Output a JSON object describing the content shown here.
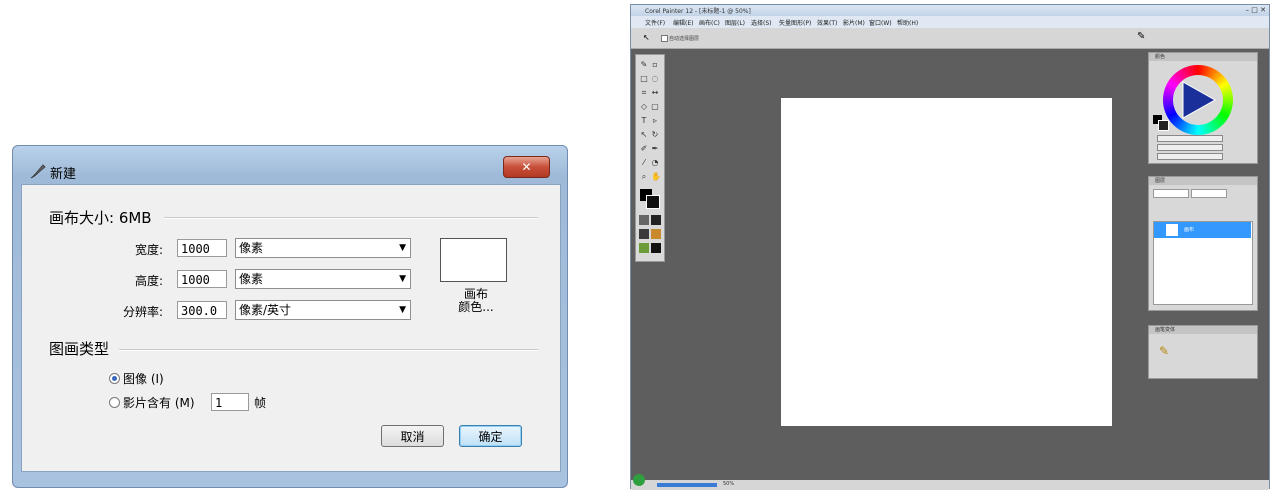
{
  "dialog": {
    "title": "新建",
    "close_label": "✕",
    "canvas_size_label": "画布大小: 6MB",
    "width_label": "宽度:",
    "width_value": "1000",
    "width_unit": "像素",
    "height_label": "高度:",
    "height_value": "1000",
    "height_unit": "像素",
    "resolution_label": "分辨率:",
    "resolution_value": "300.0",
    "resolution_unit": "像素/英寸",
    "canvas_color_line1": "画布",
    "canvas_color_line2": "颜色...",
    "picture_type_label": "图画类型",
    "image_option": "图像 (I)",
    "movie_option": "影片含有 (M)",
    "frames_value": "1",
    "frames_unit": "帧",
    "cancel_label": "取消",
    "ok_label": "确定"
  },
  "painter": {
    "title": "Corel Painter 12 - [未标题-1 @ 50%]",
    "menu": [
      "文件(F)",
      "编辑(E)",
      "画布(C)",
      "图层(L)",
      "选择(S)",
      "矢量图形(P)",
      "效果(T)",
      "影片(M)",
      "窗口(W)",
      "帮助(H)"
    ],
    "propbar_text": "自动选择图层",
    "color_panel_title": "颜色",
    "layers_panel_title": "图层",
    "layer_name": "画布",
    "brush_panel_title": "画笔变体",
    "zoom": "50%"
  },
  "colors": {
    "accent": "#3399ff",
    "workspace": "#5e5e5e"
  }
}
